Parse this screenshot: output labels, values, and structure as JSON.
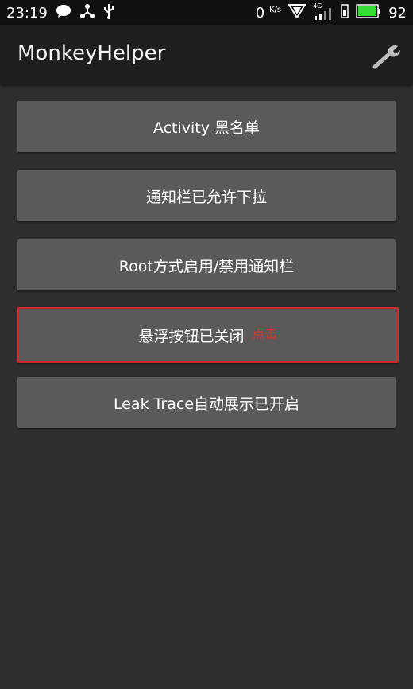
{
  "status_bar": {
    "time": "23:19",
    "net_speed_value": "0",
    "net_speed_unit": "K/s",
    "battery_level": "92",
    "network_type": "4G",
    "icons": [
      "chat-bubble-icon",
      "share-hub-icon",
      "usb-icon",
      "vpn-triangle-icon",
      "signal-icon",
      "sim-icon",
      "battery-icon"
    ]
  },
  "app_bar": {
    "title": "MonkeyHelper",
    "settings_icon": "wrench-icon"
  },
  "buttons": [
    {
      "label": "Activity 黑名单"
    },
    {
      "label": "通知栏已允许下拉"
    },
    {
      "label": "Root方式启用/禁用通知栏"
    },
    {
      "label": "悬浮按钮已关闭",
      "hint": "点击"
    },
    {
      "label": "Leak Trace自动展示已开启"
    }
  ],
  "colors": {
    "background": "#2e2e2e",
    "button": "#5a5a5a",
    "highlight": "#d12a2a",
    "battery": "#33dd33"
  }
}
